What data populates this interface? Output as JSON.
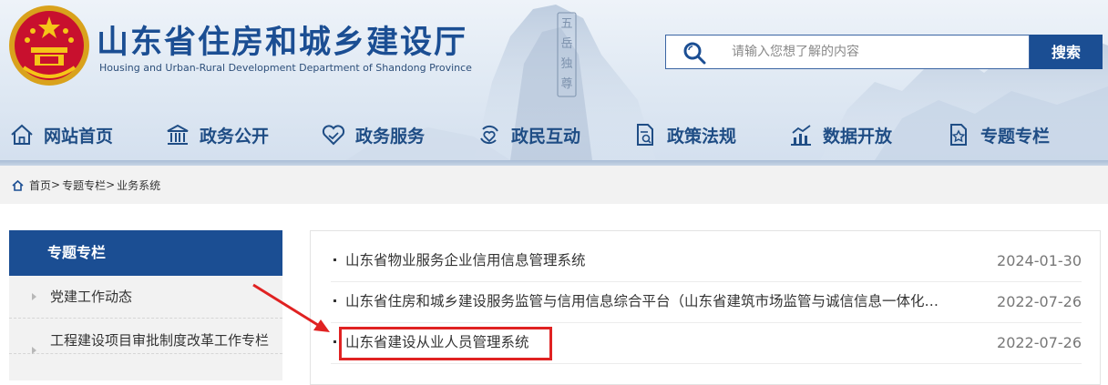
{
  "header": {
    "title": "山东省住房和城乡建设厅",
    "subtitle": "Housing and Urban-Rural Development Department of Shandong Province",
    "search": {
      "placeholder": "请输入您想了解的内容",
      "button_label": "搜索"
    },
    "seal_text": "五岳独尊"
  },
  "nav": {
    "items": [
      {
        "label": "网站首页",
        "icon": "home-icon"
      },
      {
        "label": "政务公开",
        "icon": "government-building-icon"
      },
      {
        "label": "政务服务",
        "icon": "handshake-heart-icon"
      },
      {
        "label": "政民互动",
        "icon": "interaction-icon"
      },
      {
        "label": "政策法规",
        "icon": "document-icon"
      },
      {
        "label": "数据开放",
        "icon": "chart-icon"
      },
      {
        "label": "专题专栏",
        "icon": "star-document-icon"
      }
    ]
  },
  "breadcrumb": {
    "icon": "home-icon",
    "items": [
      "首页",
      "专题专栏",
      "业务系统"
    ],
    "separator": ">"
  },
  "sidebar": {
    "title": "专题专栏",
    "items": [
      {
        "label": "党建工作动态"
      },
      {
        "label": "工程建设项目审批制度改革工作专栏"
      }
    ]
  },
  "list": {
    "items": [
      {
        "title": "山东省物业服务企业信用信息管理系统",
        "date": "2024-01-30"
      },
      {
        "title": "山东省住房和城乡建设服务监管与信用信息综合平台（山东省建筑市场监管与诚信信息一体化平台）",
        "date": "2022-07-26"
      },
      {
        "title": "山东省建设从业人员管理系统",
        "date": "2022-07-26"
      }
    ]
  },
  "colors": {
    "brand_blue": "#1b4e93",
    "nav_text": "#1f4d85",
    "highlight_red": "#e02222"
  }
}
